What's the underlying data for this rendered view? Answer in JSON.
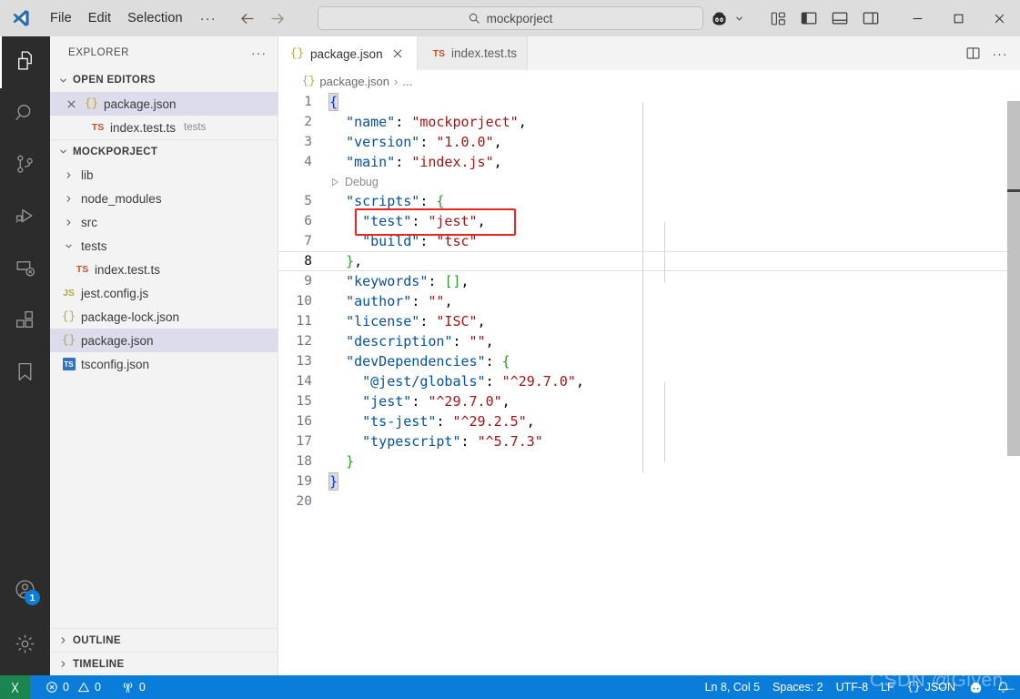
{
  "titlebar": {
    "logo_icon": "vscode-logo-icon",
    "menus": [
      "File",
      "Edit",
      "Selection"
    ],
    "more_menu_label": "···",
    "back_icon": "arrow-left-icon",
    "forward_icon": "arrow-right-icon",
    "command_center": {
      "search_icon": "search-icon",
      "value": "mockporject"
    },
    "copilot_icon": "copilot-icon",
    "copilot_chevron_icon": "chevron-down-icon",
    "layout_icons": [
      "customize-layout-icon",
      "toggle-primary-sidebar-icon",
      "toggle-panel-icon",
      "toggle-secondary-sidebar-icon"
    ],
    "window": {
      "minimize": "minimize-icon",
      "maximize": "maximize-icon",
      "close": "close-icon"
    }
  },
  "activitybar": {
    "items": [
      {
        "name": "explorer",
        "icon": "files-icon",
        "active": true
      },
      {
        "name": "search",
        "icon": "search-icon",
        "active": false
      },
      {
        "name": "source-control",
        "icon": "source-control-icon",
        "active": false
      },
      {
        "name": "run-and-debug",
        "icon": "run-debug-icon",
        "active": false
      },
      {
        "name": "remote-explorer",
        "icon": "remote-explorer-icon",
        "active": false
      },
      {
        "name": "extensions",
        "icon": "extensions-icon",
        "active": false
      },
      {
        "name": "bookmarks",
        "icon": "bookmark-icon",
        "active": false
      }
    ],
    "bottom": [
      {
        "name": "accounts",
        "icon": "account-icon",
        "badge": "1"
      },
      {
        "name": "manage",
        "icon": "gear-icon",
        "badge": ""
      }
    ]
  },
  "sidebar": {
    "title": "EXPLORER",
    "title_actions_icon": "more-actions-icon",
    "sections": [
      {
        "label": "OPEN EDITORS",
        "expanded": true
      },
      {
        "label": "MOCKPORJECT",
        "expanded": true
      },
      {
        "label": "OUTLINE",
        "expanded": false
      },
      {
        "label": "TIMELINE",
        "expanded": false
      }
    ],
    "open_editors": [
      {
        "label": "package.json",
        "icon": "json-file-icon",
        "sub": "",
        "selected": true,
        "has_close": true
      },
      {
        "label": "index.test.ts",
        "icon": "ts-file-icon",
        "sub": "tests",
        "selected": false,
        "has_close": false
      }
    ],
    "tree": [
      {
        "label": "lib",
        "type": "folder",
        "expanded": false,
        "indent": 1,
        "icon": "chevron-right-icon",
        "selected": false
      },
      {
        "label": "node_modules",
        "type": "folder",
        "expanded": false,
        "indent": 1,
        "icon": "chevron-right-icon",
        "selected": false
      },
      {
        "label": "src",
        "type": "folder",
        "expanded": false,
        "indent": 1,
        "icon": "chevron-right-icon",
        "selected": false
      },
      {
        "label": "tests",
        "type": "folder",
        "expanded": true,
        "indent": 1,
        "icon": "chevron-down-icon",
        "selected": false
      },
      {
        "label": "index.test.ts",
        "type": "ts",
        "expanded": false,
        "indent": 2,
        "icon": "ts-file-icon",
        "selected": false
      },
      {
        "label": "jest.config.js",
        "type": "js",
        "expanded": false,
        "indent": 1,
        "icon": "js-file-icon",
        "selected": false
      },
      {
        "label": "package-lock.json",
        "type": "json",
        "expanded": false,
        "indent": 1,
        "icon": "json-file-icon",
        "selected": false
      },
      {
        "label": "package.json",
        "type": "json",
        "expanded": false,
        "indent": 1,
        "icon": "json-file-icon",
        "selected": true
      },
      {
        "label": "tsconfig.json",
        "type": "tsconfig",
        "expanded": false,
        "indent": 1,
        "icon": "tsconfig-file-icon",
        "selected": false
      }
    ]
  },
  "editor": {
    "tabs": [
      {
        "label": "package.json",
        "icon": "json-file-icon",
        "active": true,
        "closable": true
      },
      {
        "label": "index.test.ts",
        "icon": "ts-file-icon",
        "active": false,
        "closable": false
      }
    ],
    "tab_actions": [
      "split-editor-icon",
      "more-actions-icon"
    ],
    "breadcrumb": {
      "icon": "json-file-icon",
      "file": "package.json",
      "separator": "›",
      "rest": "..."
    },
    "codelens": {
      "icon": "play-icon",
      "label": "Debug",
      "above_line": 5
    },
    "annotation_box": {
      "color": "#e8251f",
      "line": 6
    },
    "lines": [
      {
        "n": "1",
        "tokens": [
          {
            "t": "{",
            "c": "b1 bracket-hl"
          }
        ]
      },
      {
        "n": "2",
        "tokens": [
          {
            "t": "  ",
            "c": "p"
          },
          {
            "t": "\"name\"",
            "c": "k"
          },
          {
            "t": ": ",
            "c": "p"
          },
          {
            "t": "\"mockporject\"",
            "c": "s"
          },
          {
            "t": ",",
            "c": "p"
          }
        ]
      },
      {
        "n": "3",
        "tokens": [
          {
            "t": "  ",
            "c": "p"
          },
          {
            "t": "\"version\"",
            "c": "k"
          },
          {
            "t": ": ",
            "c": "p"
          },
          {
            "t": "\"1.0.0\"",
            "c": "s"
          },
          {
            "t": ",",
            "c": "p"
          }
        ]
      },
      {
        "n": "4",
        "tokens": [
          {
            "t": "  ",
            "c": "p"
          },
          {
            "t": "\"main\"",
            "c": "k"
          },
          {
            "t": ": ",
            "c": "p"
          },
          {
            "t": "\"index.js\"",
            "c": "s"
          },
          {
            "t": ",",
            "c": "p"
          }
        ]
      },
      {
        "n": "5",
        "tokens": [
          {
            "t": "  ",
            "c": "p"
          },
          {
            "t": "\"scripts\"",
            "c": "k"
          },
          {
            "t": ": ",
            "c": "p"
          },
          {
            "t": "{",
            "c": "b2"
          }
        ]
      },
      {
        "n": "6",
        "tokens": [
          {
            "t": "    ",
            "c": "p"
          },
          {
            "t": "\"test\"",
            "c": "k"
          },
          {
            "t": ": ",
            "c": "p"
          },
          {
            "t": "\"jest\"",
            "c": "s"
          },
          {
            "t": ",",
            "c": "p"
          }
        ]
      },
      {
        "n": "7",
        "tokens": [
          {
            "t": "    ",
            "c": "p"
          },
          {
            "t": "\"build\"",
            "c": "k"
          },
          {
            "t": ": ",
            "c": "p"
          },
          {
            "t": "\"tsc\"",
            "c": "s"
          }
        ]
      },
      {
        "n": "8",
        "tokens": [
          {
            "t": "  ",
            "c": "p"
          },
          {
            "t": "}",
            "c": "b2"
          },
          {
            "t": ",",
            "c": "p"
          }
        ],
        "current": true
      },
      {
        "n": "9",
        "tokens": [
          {
            "t": "  ",
            "c": "p"
          },
          {
            "t": "\"keywords\"",
            "c": "k"
          },
          {
            "t": ": ",
            "c": "p"
          },
          {
            "t": "[]",
            "c": "b2"
          },
          {
            "t": ",",
            "c": "p"
          }
        ]
      },
      {
        "n": "10",
        "tokens": [
          {
            "t": "  ",
            "c": "p"
          },
          {
            "t": "\"author\"",
            "c": "k"
          },
          {
            "t": ": ",
            "c": "p"
          },
          {
            "t": "\"\"",
            "c": "s"
          },
          {
            "t": ",",
            "c": "p"
          }
        ]
      },
      {
        "n": "11",
        "tokens": [
          {
            "t": "  ",
            "c": "p"
          },
          {
            "t": "\"license\"",
            "c": "k"
          },
          {
            "t": ": ",
            "c": "p"
          },
          {
            "t": "\"ISC\"",
            "c": "s"
          },
          {
            "t": ",",
            "c": "p"
          }
        ]
      },
      {
        "n": "12",
        "tokens": [
          {
            "t": "  ",
            "c": "p"
          },
          {
            "t": "\"description\"",
            "c": "k"
          },
          {
            "t": ": ",
            "c": "p"
          },
          {
            "t": "\"\"",
            "c": "s"
          },
          {
            "t": ",",
            "c": "p"
          }
        ]
      },
      {
        "n": "13",
        "tokens": [
          {
            "t": "  ",
            "c": "p"
          },
          {
            "t": "\"devDependencies\"",
            "c": "k"
          },
          {
            "t": ": ",
            "c": "p"
          },
          {
            "t": "{",
            "c": "b2"
          }
        ]
      },
      {
        "n": "14",
        "tokens": [
          {
            "t": "    ",
            "c": "p"
          },
          {
            "t": "\"@jest/globals\"",
            "c": "k"
          },
          {
            "t": ": ",
            "c": "p"
          },
          {
            "t": "\"^29.7.0\"",
            "c": "s"
          },
          {
            "t": ",",
            "c": "p"
          }
        ]
      },
      {
        "n": "15",
        "tokens": [
          {
            "t": "    ",
            "c": "p"
          },
          {
            "t": "\"jest\"",
            "c": "k"
          },
          {
            "t": ": ",
            "c": "p"
          },
          {
            "t": "\"^29.7.0\"",
            "c": "s"
          },
          {
            "t": ",",
            "c": "p"
          }
        ]
      },
      {
        "n": "16",
        "tokens": [
          {
            "t": "    ",
            "c": "p"
          },
          {
            "t": "\"ts-jest\"",
            "c": "k"
          },
          {
            "t": ": ",
            "c": "p"
          },
          {
            "t": "\"^29.2.5\"",
            "c": "s"
          },
          {
            "t": ",",
            "c": "p"
          }
        ]
      },
      {
        "n": "17",
        "tokens": [
          {
            "t": "    ",
            "c": "p"
          },
          {
            "t": "\"typescript\"",
            "c": "k"
          },
          {
            "t": ": ",
            "c": "p"
          },
          {
            "t": "\"^5.7.3\"",
            "c": "s"
          }
        ]
      },
      {
        "n": "18",
        "tokens": [
          {
            "t": "  ",
            "c": "p"
          },
          {
            "t": "}",
            "c": "b2"
          }
        ]
      },
      {
        "n": "19",
        "tokens": [
          {
            "t": "}",
            "c": "b1 bracket-hl"
          }
        ]
      },
      {
        "n": "20",
        "tokens": []
      }
    ]
  },
  "statusbar": {
    "remote_icon": "remote-indicator-icon",
    "left": [
      {
        "name": "problems",
        "icon": "error-icon",
        "value": "0",
        "icon2": "warning-icon",
        "value2": "0"
      },
      {
        "name": "ports",
        "icon": "radio-tower-icon",
        "value": "0"
      }
    ],
    "right": [
      {
        "name": "cursor-position",
        "label": "Ln 8, Col 5"
      },
      {
        "name": "indentation",
        "label": "Spaces: 2"
      },
      {
        "name": "encoding",
        "label": "UTF-8"
      },
      {
        "name": "eol",
        "label": "LF"
      },
      {
        "name": "language-mode",
        "label": "JSON",
        "icon": "json-file-icon"
      },
      {
        "name": "copilot-status",
        "label": "",
        "icon": "copilot-icon"
      },
      {
        "name": "notifications",
        "label": "",
        "icon": "bell-icon"
      }
    ]
  },
  "watermark": {
    "text": "CSDN @Given_"
  },
  "colors": {
    "accent": "#0a7ddb",
    "annotation": "#e8251f",
    "json_key": "#0451a5",
    "json_string": "#a31515",
    "bracket_blue": "#0431fa",
    "bracket_green": "#319331",
    "remote_green": "#1a8551",
    "badge_blue": "#0a7ddb"
  }
}
